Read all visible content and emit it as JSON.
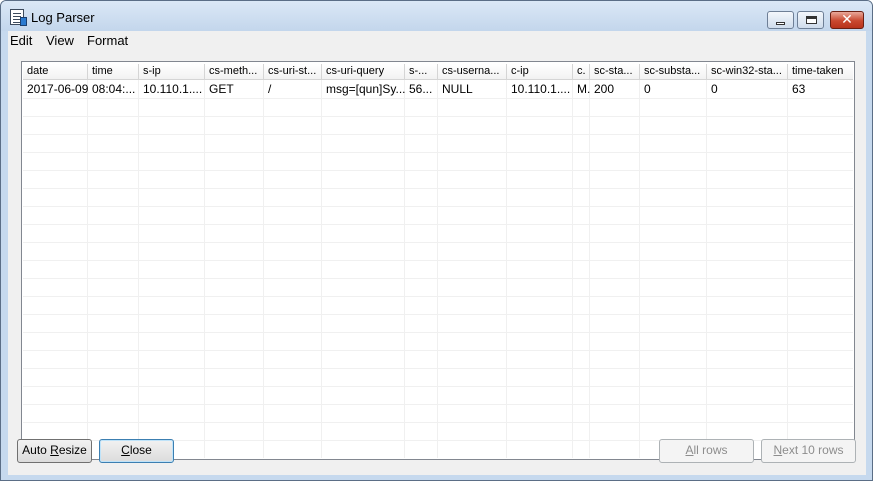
{
  "window": {
    "title": "Log Parser"
  },
  "menu": [
    "Edit",
    "View",
    "Format"
  ],
  "table": {
    "columns": [
      "date",
      "time",
      "s-ip",
      "cs-meth...",
      "cs-uri-st...",
      "cs-uri-query",
      "s-...",
      "cs-userna...",
      "c-ip",
      "c.",
      "sc-sta...",
      "sc-substa...",
      "sc-win32-sta...",
      "time-taken"
    ],
    "rows": [
      [
        "2017-06-09",
        "08:04:...",
        "10.110.1....",
        "GET",
        "/",
        "msg=[qun]Sy...",
        "56...",
        "NULL",
        "10.110.1....",
        "M.",
        "200",
        "0",
        "0",
        "63"
      ]
    ]
  },
  "buttons": {
    "auto_resize": {
      "pre": "Auto ",
      "u": "R",
      "post": "esize"
    },
    "close": {
      "pre": "",
      "u": "C",
      "post": "lose"
    },
    "all_rows": {
      "pre": "",
      "u": "A",
      "post": "ll rows"
    },
    "next_rows": {
      "pre": "",
      "u": "N",
      "post": "ext 10 rows"
    }
  },
  "colors": {
    "frame": "#c6d9ee",
    "close_button": "#c9482f",
    "disabled_text": "#8d8d8d"
  }
}
